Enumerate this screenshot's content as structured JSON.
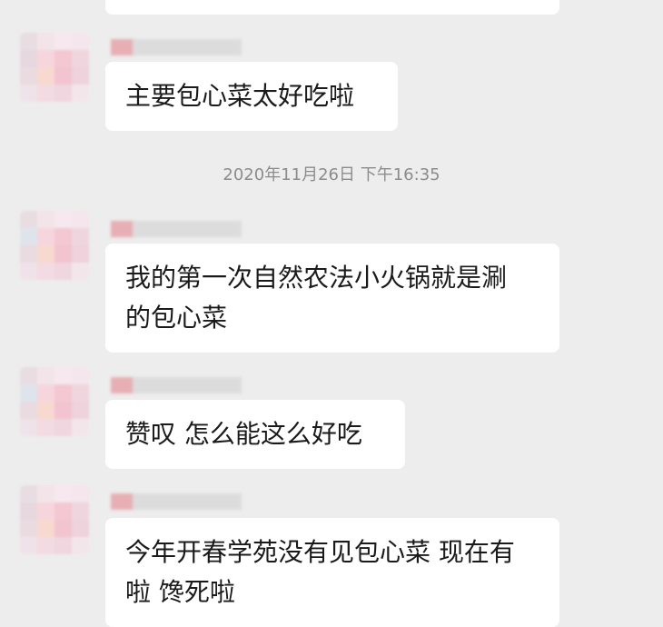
{
  "colors": {
    "background": "#ededed",
    "bubble": "#ffffff",
    "text": "#1a1a1a",
    "timestamp": "#8c8c8c"
  },
  "timestamp": "2020年11月26日 下午16:35",
  "messages": [
    {
      "text": "主要包心菜太好吃啦"
    },
    {
      "text": "我的第一次自然农法小火锅就是涮\n的包心菜"
    },
    {
      "text": "赞叹 怎么能这么好吃"
    },
    {
      "text": "今年开春学苑没有见包心菜 现在有\n啦 馋死啦"
    }
  ]
}
